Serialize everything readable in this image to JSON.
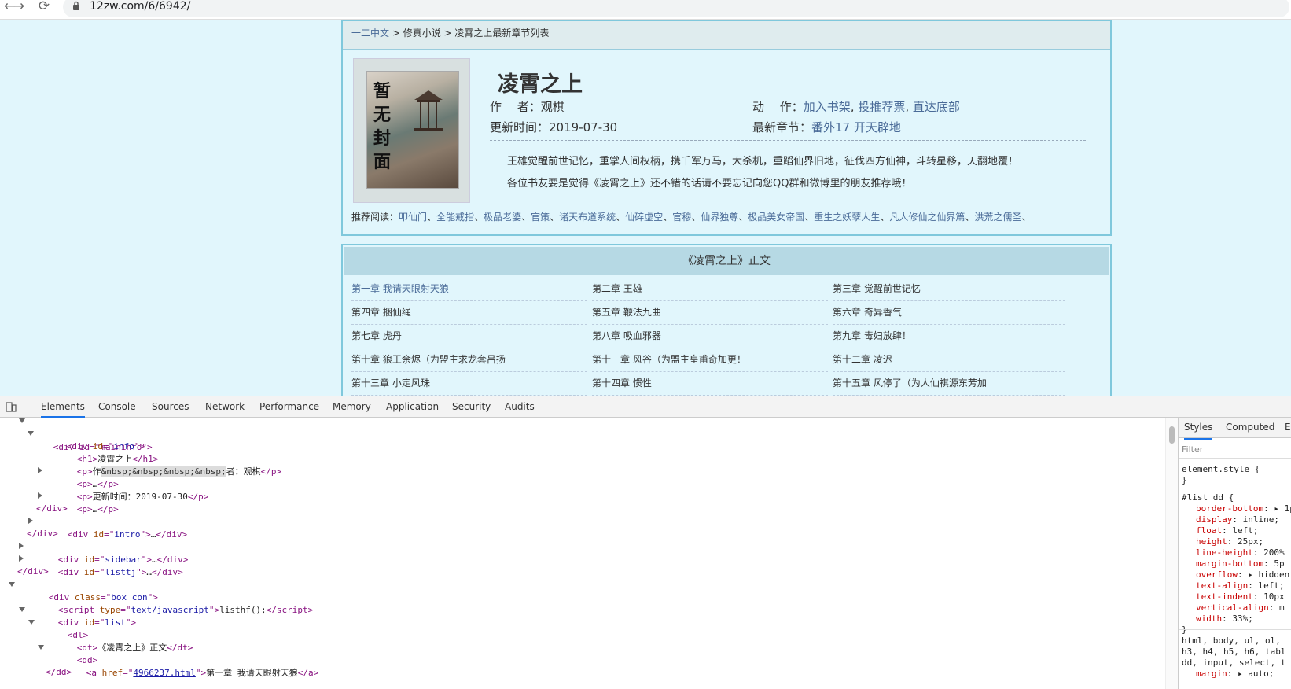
{
  "browser": {
    "url": "12zw.com/6/6942/",
    "back_icon": "←",
    "forward_icon": "→",
    "reload_icon": "⟳"
  },
  "page": {
    "breadcrumb": {
      "home": "一二中文",
      "sep1": " > ",
      "category": "修真小说",
      "sep2": " > ",
      "current": "凌霄之上最新章节列表"
    },
    "cover_text": [
      "暂",
      "无",
      "封",
      "面"
    ],
    "title": "凌霄之上",
    "author_label": "作　 者：",
    "author": "观棋",
    "actions_label": "动　 作：",
    "actions": [
      "加入书架",
      "投推荐票",
      "直达底部"
    ],
    "update_label": "更新时间：",
    "update_time": "2019-07-30",
    "latest_label": "最新章节：",
    "latest_chapter": "番外17 开天辟地",
    "intro_lines": [
      "王雄觉醒前世记忆，重掌人间权柄，携千军万马，大杀机，重蹈仙界旧地，征伐四方仙神，斗转星移，天翻地覆！",
      "各位书友要是觉得《凌霄之上》还不错的话请不要忘记向您QQ群和微博里的朋友推荐哦！"
    ],
    "recommend_label": "推荐阅读：",
    "recommend": [
      "叩仙门",
      "全能戒指",
      "极品老婆",
      "官策",
      "诸天布道系统",
      "仙碎虚空",
      "官穆",
      "仙界独尊",
      "极品美女帝国",
      "重生之妖孽人生",
      "凡人修仙之仙界篇",
      "洪荒之儒圣"
    ],
    "list_title": "《凌霄之上》正文",
    "chapters": [
      "第一章 我请天眼射天狼",
      "第二章 王雄",
      "第三章 觉醒前世记忆",
      "第四章 捆仙绳",
      "第五章 鞭法九曲",
      "第六章 奇异香气",
      "第七章 虎丹",
      "第八章 吸血邪器",
      "第九章 毒妇放肆！",
      "第十章 狼王余烬（为盟主求龙套吕扬",
      "第十一章 风谷（为盟主皇甫奇加更！",
      "第十二章 凌迟",
      "第十三章 小定风珠",
      "第十四章 惯性",
      "第十五章 风停了（为人仙祺源东芳加"
    ]
  },
  "devtools": {
    "tabs": [
      "Elements",
      "Console",
      "Sources",
      "Network",
      "Performance",
      "Memory",
      "Application",
      "Security",
      "Audits"
    ],
    "styles_tabs": [
      "Styles",
      "Computed",
      "E"
    ],
    "filter_placeholder": "Filter",
    "dom": {
      "maininfo": "<div id=\"maininfo\">",
      "info_open": "div",
      "info_id": "info",
      "h1_text": "凌霄之上",
      "p_author_prefix": "作",
      "p_author_entities": "&nbsp;&nbsp;&nbsp;&nbsp;",
      "p_author_suffix": "者：观棋",
      "p_collapsed": "…",
      "p_update": "更新时间：2019-07-30",
      "intro_id": "intro",
      "sidebar_id": "sidebar",
      "listtj_id": "listtj",
      "box_con_class": "box_con",
      "script_type": "text/javascript",
      "script_body": "listhf();",
      "list_id": "list",
      "dt_text": "《凌霄之上》正文",
      "a_href": "4966237.html",
      "a_text": "第一章 我请天眼射天狼"
    },
    "styles": {
      "element_style": "element.style {",
      "close_brace": "}",
      "list_dd_selector": "#list dd {",
      "rules": [
        [
          "border-bottom",
          "1p"
        ],
        [
          "display",
          "inline;"
        ],
        [
          "float",
          "left;"
        ],
        [
          "height",
          "25px;"
        ],
        [
          "line-height",
          "200%"
        ],
        [
          "margin-bottom",
          "5p"
        ],
        [
          "overflow",
          "hidden"
        ],
        [
          "text-align",
          "left;"
        ],
        [
          "text-indent",
          "10px"
        ],
        [
          "vertical-align",
          "m"
        ],
        [
          "width",
          "33%;"
        ]
      ],
      "reset_selector_1": "html, body, ul, ol,",
      "reset_selector_2": "h3, h4, h5, h6, tabl",
      "reset_selector_3": "dd, input, select, t",
      "reset_margin": [
        "margin",
        "auto;"
      ]
    }
  },
  "colors": {
    "page_bg": "#e1f6fc",
    "link": "#4a6b98",
    "border": "#7fc8dc",
    "list_header": "#b6d9e4"
  }
}
